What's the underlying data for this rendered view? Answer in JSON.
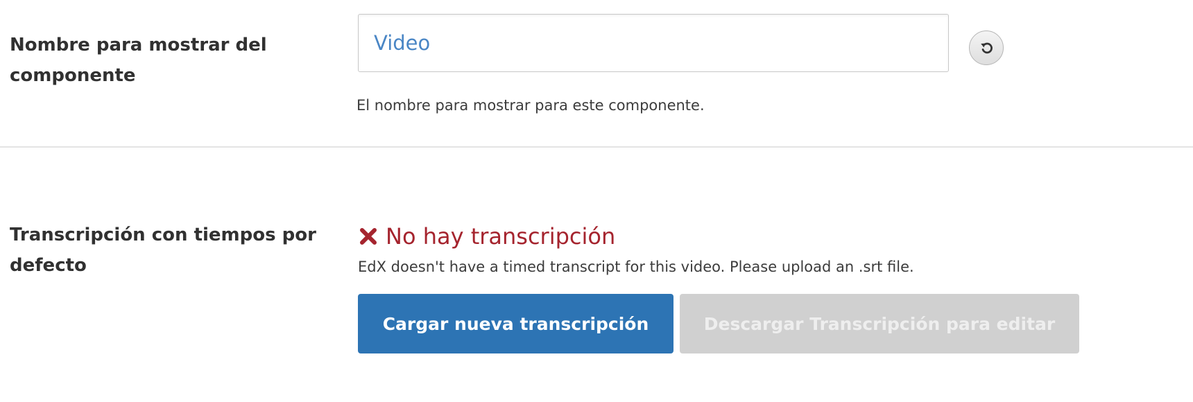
{
  "fields": {
    "display_name": {
      "label": "Nombre para mostrar del componente",
      "value": "Video",
      "help": "El nombre para mostrar para este componente.",
      "reset_icon": "reset-icon"
    },
    "transcript": {
      "label": "Transcripción con tiempos por defecto",
      "status_icon": "x-icon",
      "status_title": "No hay transcripción",
      "status_message": "EdX doesn't have a timed transcript for this video. Please upload an .srt file.",
      "upload_button": "Cargar nueva transcripción",
      "download_button": "Descargar Transcripción para editar"
    }
  },
  "colors": {
    "error": "#a5242e",
    "primary": "#2d74b4",
    "disabled": "#d0d0d0",
    "input_text": "#4a86c5"
  }
}
